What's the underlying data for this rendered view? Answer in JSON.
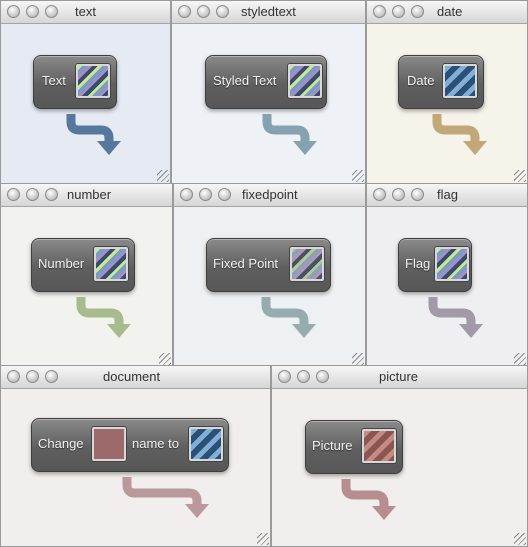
{
  "windows": {
    "text": {
      "title": "text",
      "block": {
        "label": "Text"
      },
      "colors": {
        "bg": "#e6ebf3",
        "arrow": "#56789c"
      },
      "slot_icon": "multicolor-stripes"
    },
    "styledtext": {
      "title": "styledtext",
      "block": {
        "label": "Styled Text"
      },
      "colors": {
        "bg": "#eef2f6",
        "arrow": "#86a2b0"
      },
      "slot_icon": "multicolor-stripes"
    },
    "date": {
      "title": "date",
      "block": {
        "label": "Date"
      },
      "colors": {
        "bg": "#f6f3ea",
        "arrow": "#c2a878"
      },
      "slot_icon": "blue-stripes"
    },
    "number": {
      "title": "number",
      "block": {
        "label": "Number"
      },
      "colors": {
        "bg": "#f2f3ee",
        "arrow": "#a7bb8f"
      },
      "slot_icon": "multicolor-stripes"
    },
    "fixedpoint": {
      "title": "fixedpoint",
      "block": {
        "label": "Fixed Point"
      },
      "colors": {
        "bg": "#eef1f3",
        "arrow": "#98acb0"
      },
      "slot_icon": "multicolor-stripes"
    },
    "flag": {
      "title": "flag",
      "block": {
        "label": "Flag"
      },
      "colors": {
        "bg": "#efeff2",
        "arrow": "#a29aa6"
      },
      "slot_icon": "multicolor-stripes"
    },
    "document": {
      "title": "document",
      "block": {
        "label_1": "Change",
        "label_2": "name to"
      },
      "colors": {
        "bg": "#f2eeee",
        "arrow": "#b9999b"
      },
      "slot_icons": [
        "rose-solid",
        "blue-stripes"
      ]
    },
    "picture": {
      "title": "picture",
      "block": {
        "label": "Picture"
      },
      "colors": {
        "bg": "#f2eeee",
        "arrow": "#b78e8f"
      },
      "slot_icon": "rose-stripes"
    }
  }
}
